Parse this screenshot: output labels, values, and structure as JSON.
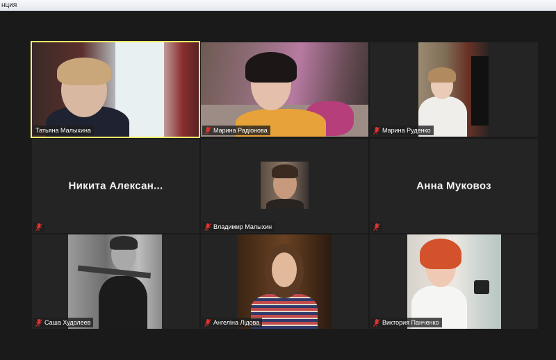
{
  "window": {
    "title": "нция"
  },
  "participants": [
    {
      "name": "Татьяна Малыхина",
      "video": true,
      "active": true
    },
    {
      "name": "Марина Радіонова",
      "video": true
    },
    {
      "name": "Марина Руденко",
      "video": true
    },
    {
      "name": "Никита  Алексан...",
      "video": false,
      "label": ""
    },
    {
      "name": "Владимир Малыхин",
      "video": true
    },
    {
      "name": "Анна Муковоз",
      "video": false,
      "label": ""
    },
    {
      "name": "Саша Худолеев",
      "video": true
    },
    {
      "name": "Ангеліна Лідова",
      "video": true
    },
    {
      "name": "Виктория Панченко",
      "video": true
    }
  ],
  "colors": {
    "active_border": "#f3f06a",
    "muted_mic": "#e5332f",
    "tile_bg": "#242424"
  },
  "icons": {
    "muted": "mic-muted-icon"
  }
}
